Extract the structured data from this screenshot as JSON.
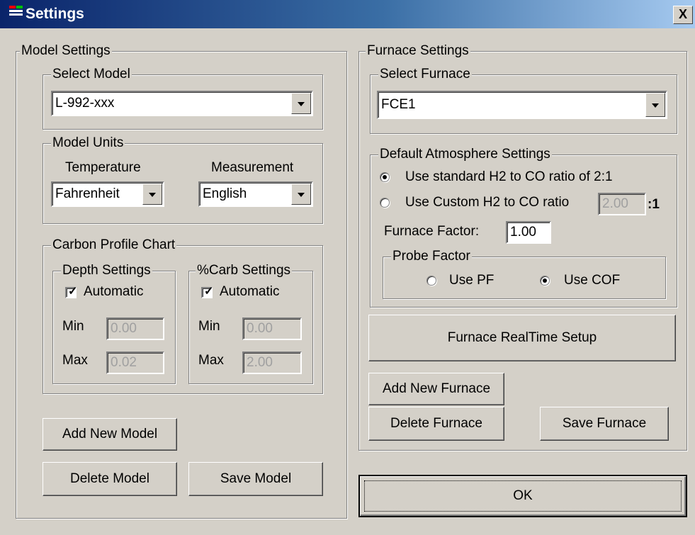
{
  "window": {
    "title": "Settings",
    "close_glyph": "X"
  },
  "model_settings": {
    "group_label": "Model Settings",
    "select_model": {
      "group_label": "Select Model",
      "value": "L-992-xxx"
    },
    "model_units": {
      "group_label": "Model Units",
      "temperature_label": "Temperature",
      "temperature_value": "Fahrenheit",
      "measurement_label": "Measurement",
      "measurement_value": "English"
    },
    "carbon_profile_chart": {
      "group_label": "Carbon Profile Chart",
      "depth": {
        "group_label": "Depth Settings",
        "automatic_label": "Automatic",
        "automatic_checked": true,
        "min_label": "Min",
        "min_value": "0.00",
        "max_label": "Max",
        "max_value": "0.02"
      },
      "carb": {
        "group_label": "%Carb Settings",
        "automatic_label": "Automatic",
        "automatic_checked": true,
        "min_label": "Min",
        "min_value": "0.00",
        "max_label": "Max",
        "max_value": "2.00"
      }
    },
    "add_new_model_label": "Add New Model",
    "delete_model_label": "Delete Model",
    "save_model_label": "Save Model"
  },
  "furnace_settings": {
    "group_label": "Furnace Settings",
    "select_furnace": {
      "group_label": "Select Furnace",
      "value": "FCE1"
    },
    "atmosphere": {
      "group_label": "Default Atmosphere Settings",
      "standard_ratio_label": "Use standard H2 to CO ratio of 2:1",
      "standard_ratio_selected": true,
      "custom_ratio_label": "Use Custom H2 to CO ratio",
      "custom_ratio_value": "2.00",
      "custom_ratio_suffix": ":1",
      "furnace_factor_label": "Furnace Factor:",
      "furnace_factor_value": "1.00",
      "probe_factor": {
        "group_label": "Probe Factor",
        "use_pf_label": "Use PF",
        "use_cof_label": "Use COF",
        "selected": "Use COF"
      }
    },
    "realtime_setup_label": "Furnace RealTime Setup",
    "add_new_furnace_label": "Add New Furnace",
    "delete_furnace_label": "Delete Furnace",
    "save_furnace_label": "Save Furnace"
  },
  "ok_label": "OK"
}
